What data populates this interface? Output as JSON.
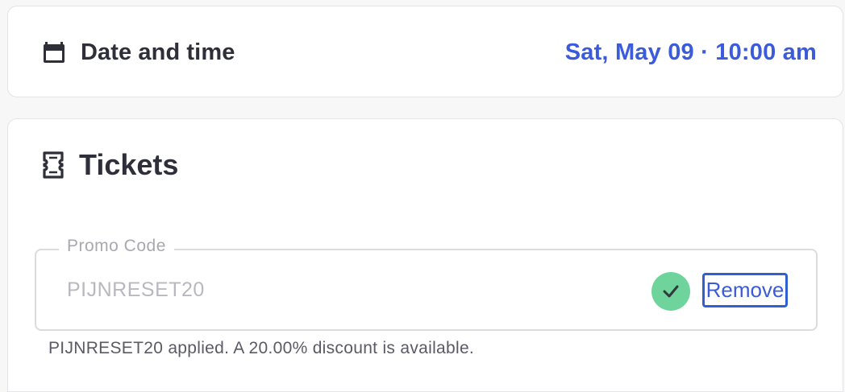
{
  "date_time": {
    "label": "Date and time",
    "value": "Sat, May 09 · 10:00 am",
    "icon": "calendar-icon"
  },
  "tickets": {
    "title": "Tickets",
    "icon": "ticket-icon"
  },
  "promo": {
    "legend": "Promo Code",
    "value": "PIJNRESET20",
    "status_icon": "check-icon",
    "remove_label": "Remove",
    "helper": "PIJNRESET20 applied. A 20.00% discount is available."
  },
  "colors": {
    "accent": "#3b5bdb",
    "success": "#6fd49b",
    "text": "#2f2f3a"
  }
}
